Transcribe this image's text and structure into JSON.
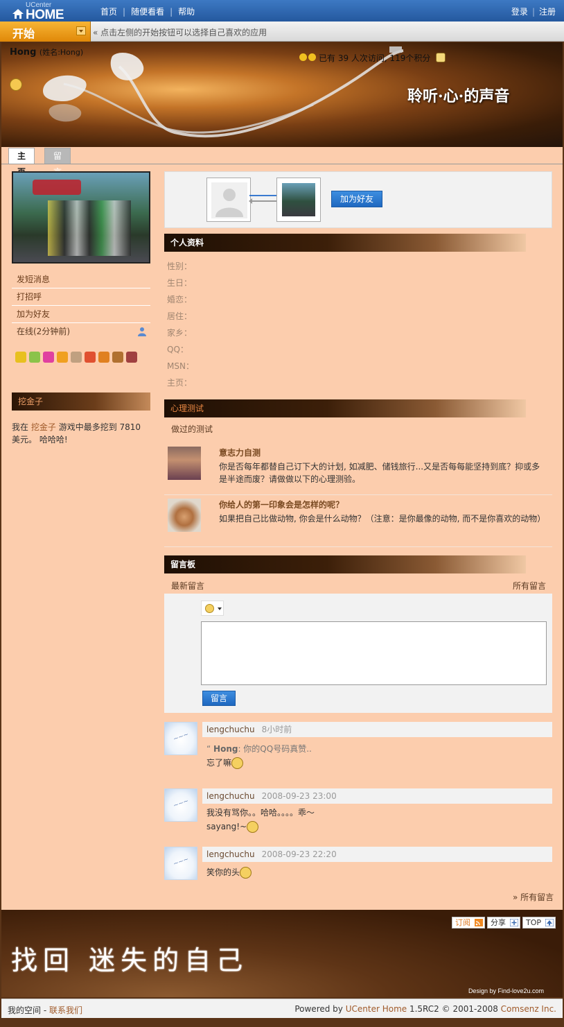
{
  "topbar": {
    "logo_small": "UCenter",
    "logo_big": "HOME",
    "nav": [
      "首页",
      "随便看看",
      "帮助"
    ],
    "login": "登录",
    "register": "注册"
  },
  "startbar": {
    "start_label": "开始",
    "hint": "« 点击左侧的开始按钮可以选择自己喜欢的应用"
  },
  "banner": {
    "username": "Hong",
    "realname": "(姓名:Hong)",
    "stats": "已有 39 人次访问, 119个积分",
    "slogan": "聆听·心·的声音"
  },
  "tabs": {
    "home": "主页",
    "guestbook": "留言"
  },
  "sidebar": {
    "menu": [
      "发短消息",
      "打招呼",
      "加为好友"
    ],
    "online": "在线(2分钟前)",
    "app_icons": [
      "#e8c020",
      "#8bc34a",
      "#e040a0",
      "#f0a020",
      "#c0a080",
      "#e05030",
      "#e08020",
      "#b07030",
      "#a04040"
    ],
    "game_title": "挖金子",
    "game_text_pre": "我在",
    "game_name": "挖金子",
    "game_text_post": "游戏中最多挖到 7810 美元。 哈哈哈!"
  },
  "friend": {
    "add_button": "加为好友"
  },
  "profile": {
    "title": "个人资料",
    "fields": [
      "性别：",
      "生日：",
      "婚恋：",
      "居住：",
      "家乡：",
      "QQ：",
      "MSN：",
      "主页："
    ]
  },
  "tests": {
    "title": "心理测试",
    "done_label": "做过的测试",
    "items": [
      {
        "title": "意志力自测",
        "desc": "你是否每年都替自己订下大的计划, 如减肥、储钱旅行...又是否每每能坚持到底？抑或多是半途而废？请做做以下的心理测验。"
      },
      {
        "title": "你给人的第一印象会是怎样的呢？",
        "desc": "如果把自己比做动物, 你会是什么动物？（注意：是你最像的动物, 而不是你喜欢的动物）"
      }
    ]
  },
  "guestbook": {
    "title": "留言板",
    "latest": "最新留言",
    "all": "所有留言",
    "submit": "留言",
    "messages": [
      {
        "user": "lengchuchu",
        "time": "8小时前",
        "quote_user": "Hong",
        "quote": ": 你的QQ号码真赞..",
        "text": "忘了嘛"
      },
      {
        "user": "lengchuchu",
        "time": "2008-09-23 23:00",
        "text": "我没有骂你。。哈哈。。。。乖～",
        "text2": "sayang!~"
      },
      {
        "user": "lengchuchu",
        "time": "2008-09-23 22:20",
        "text": "笑你的头"
      }
    ],
    "all_link": "» 所有留言"
  },
  "footer": {
    "subscribe": "订阅",
    "share": "分享",
    "top": "TOP",
    "slogan": "找回  迷失的自己",
    "design": "Design by Find-love2u.com",
    "my_space": "我的空间",
    "dash": " - ",
    "contact": "联系我们",
    "powered_pre": "Powered by ",
    "powered_link": "UCenter Home",
    "powered_mid": " 1.5RC2 © 2001-2008 ",
    "company": "Comsenz Inc."
  }
}
